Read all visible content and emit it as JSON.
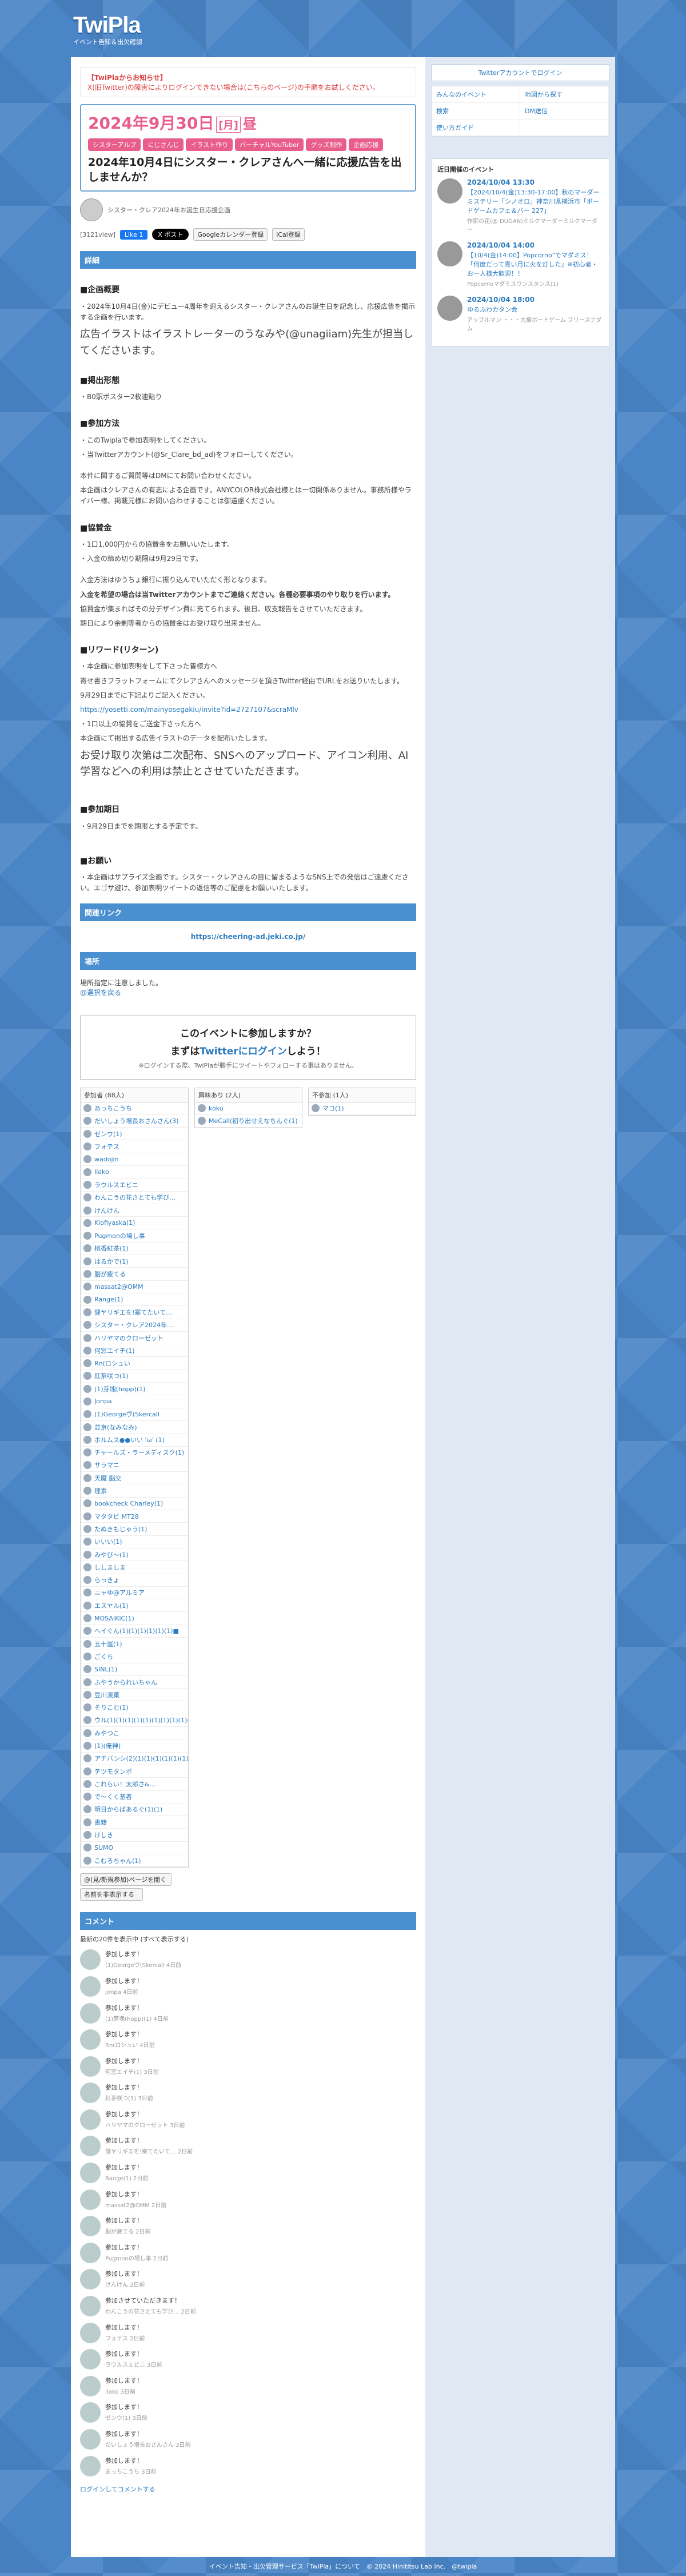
{
  "site": {
    "logo": "TwiPla",
    "tagline": "イベント告知＆出欠確認"
  },
  "notice": {
    "title": "【TwiPlaからお知らせ】",
    "body": "X(旧Twitter)の障害によりログインできない場合は(こちらのページ)の手順をお試しください。"
  },
  "event": {
    "date": "2024年9月30日",
    "dow": "[月]",
    "ampm": "昼",
    "tags": [
      "シスターアルプ",
      "にじさんじ",
      "イラスト作り",
      "バーチャルYouTuber",
      "グッズ制作",
      "企画応援"
    ],
    "title": "2024年10月4日にシスター・クレアさんへ一緒に応援広告を出しませんか？",
    "owner": "シスター・クレア2024年お誕生日応援企画",
    "views": "[3121view]",
    "like_label": "Like 1",
    "post_label": "X ポスト",
    "gcal_label": "Googleカレンダー登録",
    "ical_label": "iCal登録"
  },
  "detail": {
    "heading": "詳細",
    "s1_title": "■企画概要",
    "s1_p1": "・2024年10月4日(金)にデビュー4周年を迎えるシスター・クレアさんのお誕生日を記念し、応援広告を掲示する企画を行います。",
    "s1_p2": "広告イラストはイラストレーターのうなみや(@unagiiam)先生が担当してくださいます。",
    "s2_title": "■掲出形態",
    "s2_p1": "・B0駅ポスター2枚連貼り",
    "s3_title": "■参加方法",
    "s3_p1": "・このTwiplaで参加表明をしてください。",
    "s3_p2": "・当Twitterアカウント(@Sr_Clare_bd_ad)をフォローしてください。",
    "s3_p3": "本件に関するご質問等はDMにてお問い合わせください。",
    "s3_p4": "本企画はクレアさんの有志による企画です。ANYCOLOR株式会社様とは一切関係ありません。事務所様やライバー様、掲載元様にお問い合わせすることは御遠慮ください。",
    "s4_title": "■協賛金",
    "s4_p1": "・1口1,000円からの協賛金をお願いいたします。",
    "s4_p2": "・入金の締め切り期限は9月29日です。",
    "s4_p3": "入金方法はゆうちょ銀行に振り込んでいただく形となります。",
    "s4_p4": "入金を希望の場合は当Twitterアカウントまでご連絡ください。各種必要事項のやり取りを行います。",
    "s4_p5": "協賛金が集まればその分デザイン費に充てられます。後日、収支報告をさせていただきます。",
    "s4_p6": "期日により余剰等者からの協賛金はお受け取り出来ません。",
    "s5_title": "■リワード(リターン)",
    "s5_p1": "・本企画に参加表明をして下さった皆様方へ",
    "s5_p2": "寄せ書きプラットフォームにてクレアさんへのメッセージを頂きTwitter経由でURLをお送りいたします。",
    "s5_p3": "9月29日までに下記よりご記入ください。",
    "s5_p4": "https://yosetti.com/mainyosegakiu/invite?id=2727107&scraMlv",
    "s5_p5": "・1口以上の協賛をご送金下さった方へ",
    "s5_p6": "本企画にて掲出する広告イラストのデータを配布いたします。",
    "s5_p7": "お受け取り次第は二次配布、SNSへのアップロード、アイコン利用、AI学習などへの利用は禁止とさせていただきます。",
    "s6_title": "■参加期日",
    "s6_p1": "・9月29日までを期限とする予定です。",
    "s7_title": "■お願い",
    "s7_p1": "・本企画はサプライズ企画です。シスター・クレアさんの目に留まるようなSNS上での発信はご遠慮ください。エゴサ避け、参加表明ツイートの返信等のご配慮をお願いいたします。"
  },
  "related": {
    "heading": "関連リンク",
    "url": "https://cheering-ad.jeki.co.jp/"
  },
  "place": {
    "heading": "場所",
    "line1": "場所指定に注意しました。",
    "line2": "@選択を戻る"
  },
  "join": {
    "question": "このイベントに参加しますか？",
    "login_pre": "まずは",
    "login_link": "Twitterにログイン",
    "login_post": "しよう！",
    "note": "※ログインする際、TwiPlaが勝手にツイートやフォローする事はありません。"
  },
  "participants": {
    "col1_title": "参加者 (88人)",
    "col2_title": "興味あり (2人)",
    "col3_title": "不参加 (1人)",
    "col1": [
      "あっちこうち",
      "だいしょう増長おさんさん(3)",
      "ゼンウ(1)",
      "フォテス",
      "wadojin",
      "Ilako",
      "ラウルスエビニ",
      "わんこうの花さとても学び…",
      "けんけん",
      "Kiofiyaska(1)",
      "Pugmonの場し事",
      "桃香紅茶(1)",
      "はるかで(1)",
      "脳が疲てる",
      "massat2@OMM",
      "Range(1)",
      "健ヤリギエを!案てたいて…",
      "シスター・クレア2024年…",
      "ハリヤマのクローゼット",
      "何窓エイチ(1)",
      "Rn(ロシュい",
      "紅茶咲つ(1)",
      "(1)芽塊(hopp)(1)",
      "Jonpa",
      "(1)Georgeヴ(Skercall",
      "並京(なみなみ)",
      "ホルムス●●いい 'ω' (1)",
      "チャールズ・ラーメディスク(1)",
      "サラマニ",
      "天魔 脳交",
      "理素",
      "bookcheck Charley(1)",
      "マタタビ MT28",
      "たぬきもじゃう(1)",
      "いいい(1)",
      "みやび〜(1)",
      "ししましま",
      "らっきょ",
      "ニャゆ@アルミア",
      "エスヤル(1)",
      "MOSAIKIC(1)",
      "ヘイぐん(1)(1)(1)(1)(1)(1)■",
      "五十嵐(1)",
      "ごくち",
      "SINL(1)",
      "ふやうかられいちゃん",
      "豆川渓菓",
      "そりこむ(1)",
      "ウル(1)(1)(1)(1)(1)(1)(1)(1)(1)(1)(1)(1)(1)(1)(1)(1)(1)(1)(1)(1)(1)(1)(1)(1)(1)(1)(1)(1)(1)(1)(1)(1)(1)(1)(1)(1)(1)(1)(1)(1)(1)(1)(1)(1)(1)(1)(1)(1)(1)(1)(1)(1)(1)(1)",
      "みやつこ",
      "(1)(俺神)",
      "アチバンシ(2)(1)(1)(1)(1)(1)(1)(1)(1)(1)(1)",
      "テツモタンボ",
      "これらい！太郎さ&...",
      "で〜くく基者",
      "明日からばあるぐ(1)(1)",
      "書籍",
      "けしき",
      "SUMO",
      "こむろちゃん(1)"
    ],
    "col2": [
      "koku",
      "MeCall(初り出せえなちんぐ(1)"
    ],
    "col3": [
      "マコ(1)"
    ],
    "action1": "@(見/新規参加)ページを開く",
    "action2": "名前を非表示する"
  },
  "comments": {
    "heading": "コメント",
    "summary": "最新の20件を表示中 (すべて表示する)",
    "items": [
      {
        "text": "参加します！",
        "meta": "(1)Georgeヴ(Skercall 4日前"
      },
      {
        "text": "参加します！",
        "meta": "Jonpa 4日前"
      },
      {
        "text": "参加します！",
        "meta": "(1)芽塊(hopp)(1) 4日前"
      },
      {
        "text": "参加します！",
        "meta": "Rn(ロシュい 4日前"
      },
      {
        "text": "参加します！",
        "meta": "何窓エイチ(1) 3日前"
      },
      {
        "text": "参加します！",
        "meta": "紅茶咲つ(1) 3日前"
      },
      {
        "text": "参加します！",
        "meta": "ハリヤマのクローゼット 3日前"
      },
      {
        "text": "参加します！",
        "meta": "健ヤリギエを!案てたいて… 2日前"
      },
      {
        "text": "参加します！",
        "meta": "Range(1) 2日前"
      },
      {
        "text": "参加します！",
        "meta": "massat2@OMM 2日前"
      },
      {
        "text": "参加します！",
        "meta": "脳が疲てる 2日前"
      },
      {
        "text": "参加します！",
        "meta": "Pugmonの場し事 2日前"
      },
      {
        "text": "参加します！",
        "meta": "けんけん 2日前"
      },
      {
        "text": "参加させていただきます！",
        "meta": "わんこうの花さとても学び… 2日前"
      },
      {
        "text": "参加します！",
        "meta": "フォテス 2日前"
      },
      {
        "text": "参加します！",
        "meta": "ラウルスエビニ 3日前"
      },
      {
        "text": "参加します！",
        "meta": "Ilako 3日前"
      },
      {
        "text": "参加します！",
        "meta": "ゼンウ(1) 3日前"
      },
      {
        "text": "参加します！",
        "meta": "だいしょう増長おさんさん 3日前"
      },
      {
        "text": "参加します！",
        "meta": "あっちこうち 3日前"
      }
    ],
    "login_link": "ログインしてコメントする"
  },
  "sidebar": {
    "twitter_login": "Twitterアカウントでログイン",
    "menu": [
      "みんなのイベント",
      "地図から探す",
      "検索",
      "DM送信",
      "使い方ガイド"
    ],
    "upcoming_title": "近日開催のイベント",
    "upcoming": [
      {
        "date": "2024/10/04 13:30",
        "title": "【2024/10/4(金)13:30-17:00】秋のマーダーミステリー「シノオロ」神奈川県横浜市「ボードゲームカフェ＆バー 227」",
        "who": "作家の花(@ DUGAN)ミルクマーダーミルクマーダー"
      },
      {
        "date": "2024/10/04 14:00",
        "title": "【10/4(金)14:00】Popcorno\"でマダミス！「何度だって青い月に火を灯した」※初心者・お一人様大歓迎！！",
        "who": "Popcornoマダミスワンスタンス(1)"
      },
      {
        "date": "2024/10/04 18:00",
        "title": "ゆるふわカタン会",
        "who": "アップルマン ・・・大樹ボードゲーム ブリースナダム"
      }
    ]
  },
  "footer": "イベント告知・出欠管理サービス「TwiPla」について　© 2024 Hinititsu Lab Inc.　@twipla"
}
